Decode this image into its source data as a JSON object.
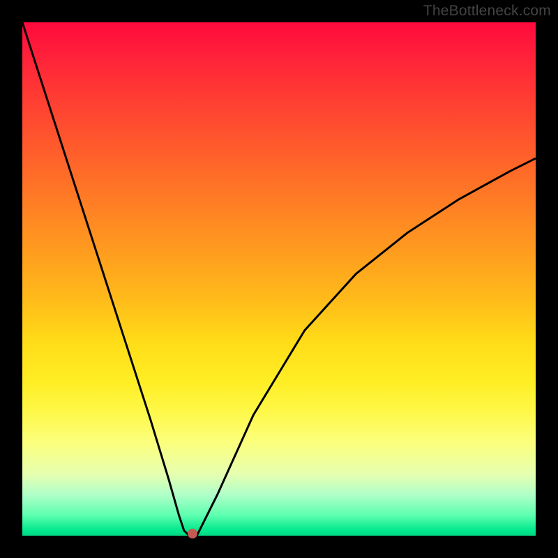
{
  "watermark": "TheBottleneck.com",
  "chart_data": {
    "type": "line",
    "title": "",
    "xlabel": "",
    "ylabel": "",
    "xlim": [
      0,
      1
    ],
    "ylim": [
      0,
      1
    ],
    "grid": false,
    "background_gradient": {
      "direction": "vertical",
      "stops": [
        {
          "pos": 0.0,
          "color": "#ff0a3c"
        },
        {
          "pos": 0.5,
          "color": "#ffbb1a"
        },
        {
          "pos": 0.8,
          "color": "#fff84a"
        },
        {
          "pos": 1.0,
          "color": "#00d884"
        }
      ]
    },
    "series": [
      {
        "name": "bottleneck-curve",
        "color": "#000000",
        "x": [
          0.0,
          0.05,
          0.1,
          0.15,
          0.2,
          0.25,
          0.285,
          0.305,
          0.315,
          0.325,
          0.34,
          0.38,
          0.45,
          0.55,
          0.65,
          0.75,
          0.85,
          0.95,
          1.0
        ],
        "y": [
          1.0,
          0.845,
          0.69,
          0.535,
          0.38,
          0.225,
          0.11,
          0.04,
          0.01,
          0.0,
          0.0,
          0.08,
          0.235,
          0.4,
          0.51,
          0.59,
          0.655,
          0.71,
          0.735
        ]
      }
    ],
    "annotations": [
      {
        "type": "point",
        "name": "minimum-marker",
        "x": 0.325,
        "y": 0.0,
        "color": "#c65a52"
      }
    ]
  }
}
